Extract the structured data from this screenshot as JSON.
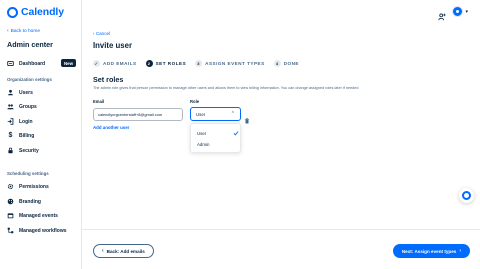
{
  "brand": {
    "name": "Calendly",
    "color": "#006bff"
  },
  "sidebar": {
    "back_label": "Back to home",
    "title": "Admin center",
    "dashboard": {
      "label": "Dashboard",
      "badge": "New",
      "icon": "dashboard-icon"
    },
    "org_section": "Organization settings",
    "org_items": [
      {
        "label": "Users",
        "icon": "users-icon"
      },
      {
        "label": "Groups",
        "icon": "groups-icon"
      },
      {
        "label": "Login",
        "icon": "login-icon"
      },
      {
        "label": "Billing",
        "icon": "dollar-icon"
      },
      {
        "label": "Security",
        "icon": "lock-icon"
      }
    ],
    "sched_section": "Scheduling settings",
    "sched_items": [
      {
        "label": "Permissions",
        "icon": "gear-icon"
      },
      {
        "label": "Branding",
        "icon": "palette-icon"
      },
      {
        "label": "Managed events",
        "icon": "calendar-icon"
      },
      {
        "label": "Managed workflows",
        "icon": "workflow-icon"
      }
    ]
  },
  "main": {
    "cancel_label": "Cancel",
    "title": "Invite user",
    "steps": [
      {
        "num": "✓",
        "label": "ADD EMAILS",
        "state": "done"
      },
      {
        "num": "2",
        "label": "SET ROLES",
        "state": "active"
      },
      {
        "num": "3",
        "label": "ASSIGN EVENT TYPES",
        "state": "pending"
      },
      {
        "num": "4",
        "label": "DONE",
        "state": "pending"
      }
    ],
    "section_title": "Set roles",
    "description": "The admin role gives that person permission to manage other users and allows them to view billing information. You can change assigned roles later if needed",
    "email_label": "Email",
    "role_label": "Role",
    "email_value": "calendlyorgcenterstaff+8@gmail.com",
    "role_value": "User",
    "add_another_label": "Add another user",
    "role_options": [
      {
        "label": "User",
        "selected": true
      },
      {
        "label": "Admin",
        "selected": false
      }
    ]
  },
  "footer": {
    "back_label": "Back: Add emails",
    "next_label": "Next: Assign event types"
  }
}
